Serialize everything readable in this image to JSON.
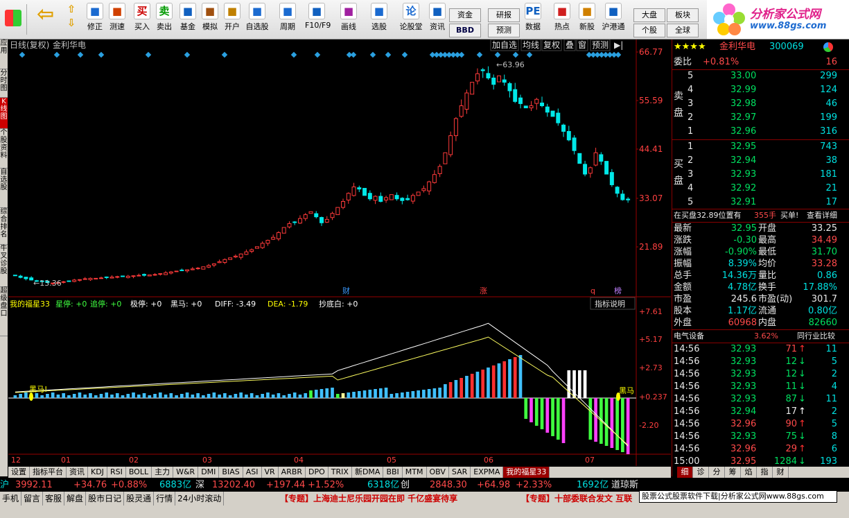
{
  "toolbar": {
    "buttons": [
      {
        "label": "修正",
        "icon": "up-down-arrows-icon"
      },
      {
        "label": "测速",
        "icon": "speed-icon"
      },
      {
        "label": "买入",
        "icon": "buy-icon",
        "glyph": "买"
      },
      {
        "label": "卖出",
        "icon": "sell-icon",
        "glyph": "卖"
      },
      {
        "label": "基金",
        "icon": "fund-icon"
      },
      {
        "label": "模拟",
        "icon": "hammer-icon"
      },
      {
        "label": "开户",
        "icon": "lock-icon"
      },
      {
        "label": "自选股",
        "icon": "star-list-icon"
      },
      {
        "label": "周期",
        "icon": "clock-icon"
      },
      {
        "label": "F10/F9",
        "icon": "f10-icon"
      },
      {
        "label": "画线",
        "icon": "pen-icon"
      },
      {
        "label": "选股",
        "icon": "screen-icon"
      },
      {
        "label": "论股堂",
        "icon": "forum-icon",
        "glyph": "论"
      },
      {
        "label": "资讯",
        "icon": "news-icon"
      },
      {
        "label": "数据",
        "icon": "pe-icon",
        "glyph": "PE"
      },
      {
        "label": "热点",
        "icon": "hot-icon"
      },
      {
        "label": "新股",
        "icon": "new-stock-icon"
      },
      {
        "label": "沪港通",
        "icon": "hk-connect-icon"
      }
    ],
    "small_buttons": {
      "fund": "资金",
      "bbd": "BBD",
      "research": "研报",
      "forecast": "预测",
      "market": "大盘",
      "board": "板块",
      "stock": "个股",
      "global": "全球"
    }
  },
  "logo": {
    "title": "分析家公式网",
    "url": "www.88gs.com"
  },
  "left_tabs": [
    "应用",
    "分时图",
    "K线图",
    "个股资料",
    "自选股",
    "综合排名",
    "牛叉诊股",
    "超级盘口"
  ],
  "chart": {
    "period_label": "日线(复权)",
    "stock_name": "金利华电",
    "buttons": [
      "加自选",
      "均线",
      "复权",
      "叠",
      "窗",
      "预测"
    ],
    "price_axis": [
      "66.77",
      "55.59",
      "44.41",
      "33.07",
      "21.89"
    ],
    "high_label": "63.96",
    "low_label": "13.36",
    "event_markers": [
      "财",
      "涨",
      "q",
      "榜"
    ],
    "indicator_line": {
      "name": "我的福星33",
      "items": [
        "星停: +0",
        "追停: +0",
        "极停: +0",
        "黑马: +0",
        "DIFF: -3.49",
        "DEA: -1.79",
        "抄底白: +0"
      ]
    },
    "indicator_help": "指标说明",
    "indicator_axis": [
      "+7.61",
      "+5.17",
      "+2.73",
      "+0.237",
      "-2.20"
    ],
    "heima_label_left": "黑马!",
    "heima_label_right": "黑马",
    "months": [
      "12",
      "01",
      "02",
      "03",
      "04",
      "05",
      "06",
      "07"
    ]
  },
  "chart_data": {
    "type": "candlestick",
    "title": "金利华电 日线(复权)",
    "ylim": [
      13.36,
      66.77
    ],
    "ticks": [
      66.77,
      55.59,
      44.41,
      33.07,
      21.89
    ],
    "high": 63.96,
    "low": 13.36,
    "close_series": [
      15.2,
      14.8,
      14.5,
      14.2,
      14.0,
      13.8,
      13.6,
      13.5,
      13.6,
      13.8,
      14.0,
      14.2,
      14.3,
      14.5,
      14.6,
      14.6,
      14.7,
      14.8,
      14.9,
      15.0,
      15.0,
      15.1,
      15.2,
      15.3,
      15.3,
      15.4,
      15.5,
      15.7,
      15.9,
      16.1,
      16.3,
      16.5,
      16.6,
      16.8,
      17.0,
      17.3,
      17.6,
      18.0,
      18.5,
      19.0,
      19.4,
      19.8,
      20.3,
      20.8,
      21.3,
      22.0,
      22.8,
      23.5,
      24.2,
      25.3,
      26.5,
      27.4,
      27.8,
      28.6,
      29.5,
      30.2,
      29.0,
      27.6,
      28.4,
      29.8,
      31.2,
      32.6,
      34.5,
      36.0,
      35.5,
      34.0,
      33.2,
      33.8,
      32.6,
      33.5,
      34.2,
      33.2,
      32.8,
      33.0,
      34.0,
      34.8,
      35.6,
      37.2,
      38.9,
      40.8,
      44.0,
      48.0,
      52.0,
      55.0,
      58.0,
      60.5,
      62.5,
      63.2,
      61.5,
      60.0,
      62.0,
      60.5,
      58.5,
      56.0,
      55.5,
      54.5,
      55.0,
      56.5,
      55.0,
      53.5,
      52.5,
      51.0,
      49.0,
      47.0,
      44.5,
      41.5,
      39.0,
      40.5,
      44.0,
      42.0,
      39.0,
      36.5,
      34.5,
      33.0,
      32.95
    ],
    "indicator_ylim": [
      -3.2,
      8.2
    ],
    "indicator_ticks": [
      7.61,
      5.17,
      2.73,
      0.237,
      -2.2
    ],
    "DIFF": -3.49,
    "DEA": -1.79
  },
  "quote": {
    "stars": "★★★★",
    "name": "金利华电",
    "code": "300069",
    "weibi_label": "委比",
    "weibi_value": "+0.81%",
    "weibi_diff": "16",
    "sell_label": "卖盘",
    "buy_label": "买盘",
    "sells": [
      {
        "n": "5",
        "price": "33.00",
        "vol": "299"
      },
      {
        "n": "4",
        "price": "32.99",
        "vol": "124"
      },
      {
        "n": "3",
        "price": "32.98",
        "vol": "46"
      },
      {
        "n": "2",
        "price": "32.97",
        "vol": "199"
      },
      {
        "n": "1",
        "price": "32.96",
        "vol": "316"
      }
    ],
    "buys": [
      {
        "n": "1",
        "price": "32.95",
        "vol": "743"
      },
      {
        "n": "2",
        "price": "32.94",
        "vol": "38"
      },
      {
        "n": "3",
        "price": "32.93",
        "vol": "181"
      },
      {
        "n": "4",
        "price": "32.92",
        "vol": "21"
      },
      {
        "n": "5",
        "price": "32.91",
        "vol": "17"
      }
    ],
    "position_text": "在买盘32.89位置有",
    "position_vol": "355手",
    "position_action": "买单!",
    "position_detail": "查看详细",
    "stats": [
      {
        "l1": "最新",
        "v1": "32.95",
        "c1": "grn",
        "l2": "开盘",
        "v2": "33.25",
        "c2": "wht"
      },
      {
        "l1": "涨跌",
        "v1": "-0.30",
        "c1": "grn",
        "l2": "最高",
        "v2": "34.49",
        "c2": "red"
      },
      {
        "l1": "涨幅",
        "v1": "-0.90%",
        "c1": "grn",
        "l2": "最低",
        "v2": "31.70",
        "c2": "grn"
      },
      {
        "l1": "振幅",
        "v1": "8.39%",
        "c1": "cyan",
        "l2": "均价",
        "v2": "33.28",
        "c2": "red"
      },
      {
        "l1": "总手",
        "v1": "14.36万",
        "c1": "cyan",
        "l2": "量比",
        "v2": "0.86",
        "c2": "cyan"
      },
      {
        "l1": "金额",
        "v1": "4.78亿",
        "c1": "cyan",
        "l2": "换手",
        "v2": "17.88%",
        "c2": "cyan"
      },
      {
        "l1": "市盈",
        "v1": "245.6",
        "c1": "wht",
        "l2": "市盈(动)",
        "v2": "301.7",
        "c2": "wht"
      },
      {
        "l1": "股本",
        "v1": "1.17亿",
        "c1": "cyan",
        "l2": "流通",
        "v2": "0.80亿",
        "c2": "cyan"
      },
      {
        "l1": "外盘",
        "v1": "60968",
        "c1": "red",
        "l2": "内盘",
        "v2": "82660",
        "c2": "grn"
      }
    ],
    "industry": "电气设备",
    "industry_pct": "3.62%",
    "industry_compare": "同行业比较",
    "ticks": [
      {
        "t": "14:56",
        "p": "32.93",
        "v": "71",
        "d": "up",
        "n": "11"
      },
      {
        "t": "14:56",
        "p": "32.93",
        "v": "12",
        "d": "down",
        "n": "5"
      },
      {
        "t": "14:56",
        "p": "32.93",
        "v": "12",
        "d": "down",
        "n": "2"
      },
      {
        "t": "14:56",
        "p": "32.93",
        "v": "11",
        "d": "down",
        "n": "4"
      },
      {
        "t": "14:56",
        "p": "32.93",
        "v": "87",
        "d": "down",
        "n": "11"
      },
      {
        "t": "14:56",
        "p": "32.94",
        "v": "17",
        "d": "flat",
        "n": "2"
      },
      {
        "t": "14:56",
        "p": "32.96",
        "v": "90",
        "d": "up",
        "n": "5"
      },
      {
        "t": "14:56",
        "p": "32.93",
        "v": "75",
        "d": "down",
        "n": "8"
      },
      {
        "t": "14:56",
        "p": "32.96",
        "v": "29",
        "d": "up",
        "n": "6"
      },
      {
        "t": "15:00",
        "p": "32.95",
        "v": "1284",
        "d": "down",
        "n": "193"
      }
    ]
  },
  "bottom_tabs": [
    "设置",
    "指标平台",
    "资讯",
    "KDJ",
    "RSI",
    "BOLL",
    "主力",
    "W&R",
    "DMI",
    "BIAS",
    "ASI",
    "VR",
    "ARBR",
    "DPO",
    "TRIX",
    "新DMA",
    "BBI",
    "MTM",
    "OBV",
    "SAR",
    "EXPMA",
    "我的福星33"
  ],
  "right_tabs": [
    "细",
    "诊",
    "分",
    "筹",
    "焰",
    "指",
    "财"
  ],
  "status": {
    "sh_index": "3992.11",
    "sh_change": "+34.76",
    "sh_pct": "+0.88%",
    "sh_amount": "6883亿",
    "sz_label": "深",
    "sz_index": "13202.40",
    "sz_change": "+197.44",
    "sz_pct": "+1.52%",
    "sz_amount": "6318亿",
    "cy_label": "创",
    "cy_index": "2848.30",
    "cy_change": "+64.98",
    "cy_pct": "+2.33%",
    "cy_amount": "1692亿",
    "dj_label": "道琼斯"
  },
  "status2": {
    "items": [
      "手机",
      "留言",
      "客服",
      "解盘",
      "股市日记",
      "股灵通",
      "行情",
      "24小时滚动"
    ],
    "news1": "【专题】上海迪士尼乐园开园在即 千亿盛宴待享",
    "news2": "【专题】十部委联合发文 互联",
    "watermark": "股票公式股票软件下载|分析家公式网www.88gs.com"
  },
  "colors": {
    "up": "#ff3a3a",
    "down": "#00e8e8",
    "grid": "#800000",
    "axis_text": "#ff4040"
  }
}
